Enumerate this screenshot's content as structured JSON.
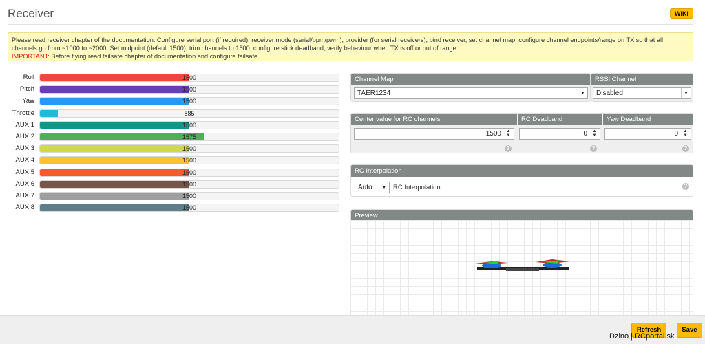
{
  "header": {
    "title": "Receiver",
    "wiki_label": "WIKI"
  },
  "note": {
    "text": "Please read receiver chapter of the documentation. Configure serial port (if required), receiver mode (serial/ppm/pwm), provider (for serial receivers), bind receiver, set channel map, configure channel endpoints/range on TX so that all channels go from ~1000 to ~2000. Set midpoint (default 1500), trim channels to 1500, configure stick deadband, verify behaviour when TX is off or out of range.",
    "important_label": "IMPORTANT:",
    "important_text": " Before flying read failsafe chapter of documentation and configure failsafe."
  },
  "channels": [
    {
      "label": "Roll",
      "value": "1500",
      "level": 0.5,
      "color": "#f1453d"
    },
    {
      "label": "Pitch",
      "value": "1500",
      "level": 0.5,
      "color": "#673fb4"
    },
    {
      "label": "Yaw",
      "value": "1500",
      "level": 0.5,
      "color": "#2b98f0"
    },
    {
      "label": "Throttle",
      "value": "885",
      "level": 0.06,
      "color": "#1fbcd2"
    },
    {
      "label": "AUX 1",
      "value": "1500",
      "level": 0.5,
      "color": "#159588"
    },
    {
      "label": "AUX 2",
      "value": "1575",
      "level": 0.55,
      "color": "#50ae55"
    },
    {
      "label": "AUX 3",
      "value": "1500",
      "level": 0.5,
      "color": "#cdda49"
    },
    {
      "label": "AUX 4",
      "value": "1500",
      "level": 0.5,
      "color": "#fdc02f"
    },
    {
      "label": "AUX 5",
      "value": "1500",
      "level": 0.5,
      "color": "#fc5830"
    },
    {
      "label": "AUX 6",
      "value": "1500",
      "level": 0.5,
      "color": "#785549"
    },
    {
      "label": "AUX 7",
      "value": "1500",
      "level": 0.5,
      "color": "#9e9e9e"
    },
    {
      "label": "AUX 8",
      "value": "1500",
      "level": 0.5,
      "color": "#617d8a"
    }
  ],
  "channel_map": {
    "header": "Channel Map",
    "value": "TAER1234"
  },
  "rssi": {
    "header": "RSSI Channel",
    "value": "Disabled"
  },
  "center": {
    "header": "Center value for RC channels",
    "value": "1500"
  },
  "rc_deadband": {
    "header": "RC Deadband",
    "value": "0"
  },
  "yaw_deadband": {
    "header": "Yaw Deadband",
    "value": "0"
  },
  "interpolation": {
    "header": "RC Interpolation",
    "value": "Auto",
    "label": "RC Interpolation"
  },
  "preview": {
    "header": "Preview"
  },
  "footer": {
    "refresh_label": "Refresh",
    "save_label": "Save"
  },
  "watermark": "Dzino | RCportal.sk",
  "help_glyph": "?",
  "colors": {
    "accent": "#ffbb00",
    "panel_header": "#828885",
    "note_bg": "#fffac2",
    "important": "#e2231a"
  }
}
